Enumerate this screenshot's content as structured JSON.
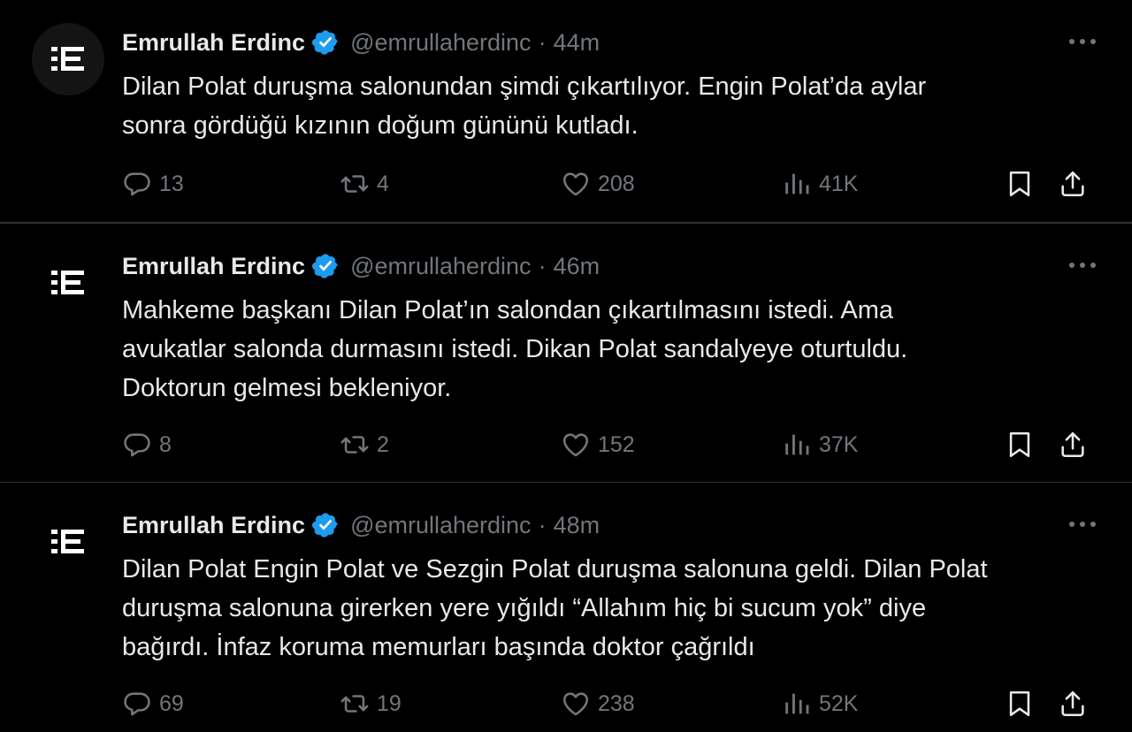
{
  "tweets": [
    {
      "author_name": "Emrullah Erdinc",
      "handle": "@emrullaherdinc",
      "separator": "·",
      "time": "44m",
      "text": "Dilan Polat duruşma salonundan şimdi çıkartılıyor. Engin Polat’da aylar\nsonra gördüğü kızının doğum gününü kutladı.",
      "replies": "13",
      "retweets": "4",
      "likes": "208",
      "views": "41K"
    },
    {
      "author_name": "Emrullah Erdinc",
      "handle": "@emrullaherdinc",
      "separator": "·",
      "time": "46m",
      "text": "Mahkeme başkanı Dilan Polat’ın salondan çıkartılmasını istedi. Ama\navukatlar salonda durmasını istedi. Dikan Polat sandalyeye oturtuldu.\nDoktorun gelmesi bekleniyor.",
      "replies": "8",
      "retweets": "2",
      "likes": "152",
      "views": "37K"
    },
    {
      "author_name": "Emrullah Erdinc",
      "handle": "@emrullaherdinc",
      "separator": "·",
      "time": "48m",
      "text": "Dilan Polat Engin Polat ve Sezgin Polat duruşma salonuna geldi. Dilan Polat\nduruşma salonuna girerken yere yığıldı “Allahım hiç bi sucum yok” diye\nbağırdı. İnfaz koruma memurları başında doktor çağrıldı",
      "replies": "69",
      "retweets": "19",
      "likes": "238",
      "views": "52K"
    }
  ],
  "icons": {
    "avatar": "ee-logo-icon",
    "verified": "verified-badge-icon",
    "more": "more-dots-icon",
    "reply": "reply-icon",
    "retweet": "retweet-icon",
    "like": "heart-icon",
    "views": "views-icon",
    "bookmark": "bookmark-icon",
    "share": "share-icon"
  },
  "colors": {
    "background": "#000000",
    "text": "#e7e9ea",
    "muted": "#71767b",
    "verified_blue": "#1d9bf0",
    "divider": "#2f3336"
  }
}
